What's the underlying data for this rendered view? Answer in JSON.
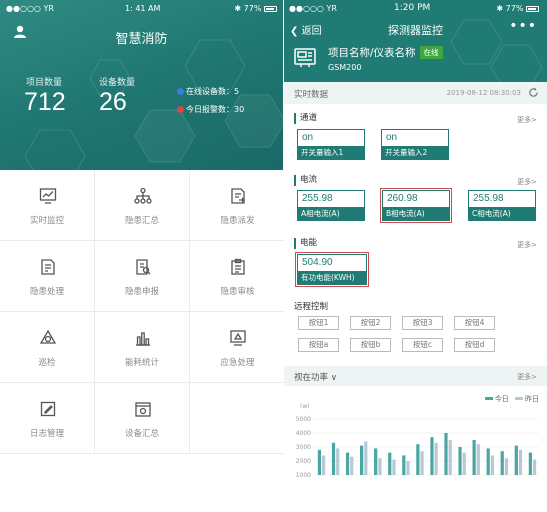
{
  "left": {
    "status": {
      "carrier": "●●○○○ YR",
      "time": "1: 41 AM",
      "battery": "77%"
    },
    "title": "智慧消防",
    "stats": [
      {
        "label": "项目数量",
        "value": "712"
      },
      {
        "label": "设备数量",
        "value": "26"
      }
    ],
    "alerts": [
      {
        "label": "在线设备数：",
        "value": "5",
        "color": "#3b7be0"
      },
      {
        "label": "今日报警数：",
        "value": "30",
        "color": "#e04545"
      }
    ],
    "menu": [
      {
        "label": "实时监控",
        "icon": "monitor-chart-icon"
      },
      {
        "label": "隐患汇总",
        "icon": "org-tree-icon"
      },
      {
        "label": "隐患派发",
        "icon": "doc-dispatch-icon"
      },
      {
        "label": "隐患处理",
        "icon": "doc-process-icon"
      },
      {
        "label": "隐患申报",
        "icon": "doc-report-icon"
      },
      {
        "label": "隐患审核",
        "icon": "clipboard-review-icon"
      },
      {
        "label": "巡检",
        "icon": "patrol-icon"
      },
      {
        "label": "能耗统计",
        "icon": "bar-stats-icon"
      },
      {
        "label": "应急处理",
        "icon": "emergency-icon"
      },
      {
        "label": "日志管理",
        "icon": "log-edit-icon"
      },
      {
        "label": "设备汇总",
        "icon": "device-summary-icon"
      }
    ]
  },
  "right": {
    "status": {
      "carrier": "●●○○○ YR",
      "time": "1:20 PM",
      "battery": "77%"
    },
    "back_label": "返回",
    "title": "探测器监控",
    "device": {
      "name": "项目名称/仪表名称",
      "badge": "在线",
      "model": "GSM200"
    },
    "realtime": {
      "label": "实时数据",
      "time": "2019-08-12 08:30:03"
    },
    "sections": {
      "channel": {
        "title": "通道",
        "more": "更多>",
        "items": [
          {
            "value": "on",
            "key": "开关量输入1"
          },
          {
            "value": "on",
            "key": "开关量输入2"
          }
        ]
      },
      "current": {
        "title": "电流",
        "more": "更多>",
        "items": [
          {
            "value": "255.98",
            "key": "A相电流(A)"
          },
          {
            "value": "260.98",
            "key": "B相电流(A)"
          },
          {
            "value": "255.98",
            "key": "C相电流(A)"
          }
        ]
      },
      "energy": {
        "title": "电能",
        "more": "更多>",
        "items": [
          {
            "value": "504.90",
            "key": "有功电能(KWH)"
          }
        ]
      }
    },
    "remote": {
      "title": "远程控制",
      "buttons": [
        "按钮1",
        "按钮2",
        "按钮3",
        "按钮4",
        "按钮a",
        "按钮b",
        "按钮c",
        "按钮d"
      ]
    },
    "power": {
      "title": "视在功率",
      "more": "更多>"
    },
    "chart_data": {
      "type": "bar",
      "ylabel": "(w)",
      "yticks": [
        1000,
        2000,
        3000,
        4000,
        5000
      ],
      "ylim": [
        1000,
        5500
      ],
      "series": [
        {
          "name": "今日",
          "color": "#4aa6a0",
          "values": [
            2800,
            3300,
            2600,
            3100,
            2900,
            2600,
            2400,
            3200,
            3700,
            4000,
            3000,
            3500,
            2900,
            2700,
            3100,
            2600
          ]
        },
        {
          "name": "昨日",
          "color": "#b8c9d6",
          "values": [
            2400,
            2900,
            2300,
            3400,
            2200,
            2100,
            2000,
            2700,
            3300,
            3500,
            2600,
            3200,
            2400,
            2200,
            2800,
            2100
          ]
        }
      ]
    }
  }
}
